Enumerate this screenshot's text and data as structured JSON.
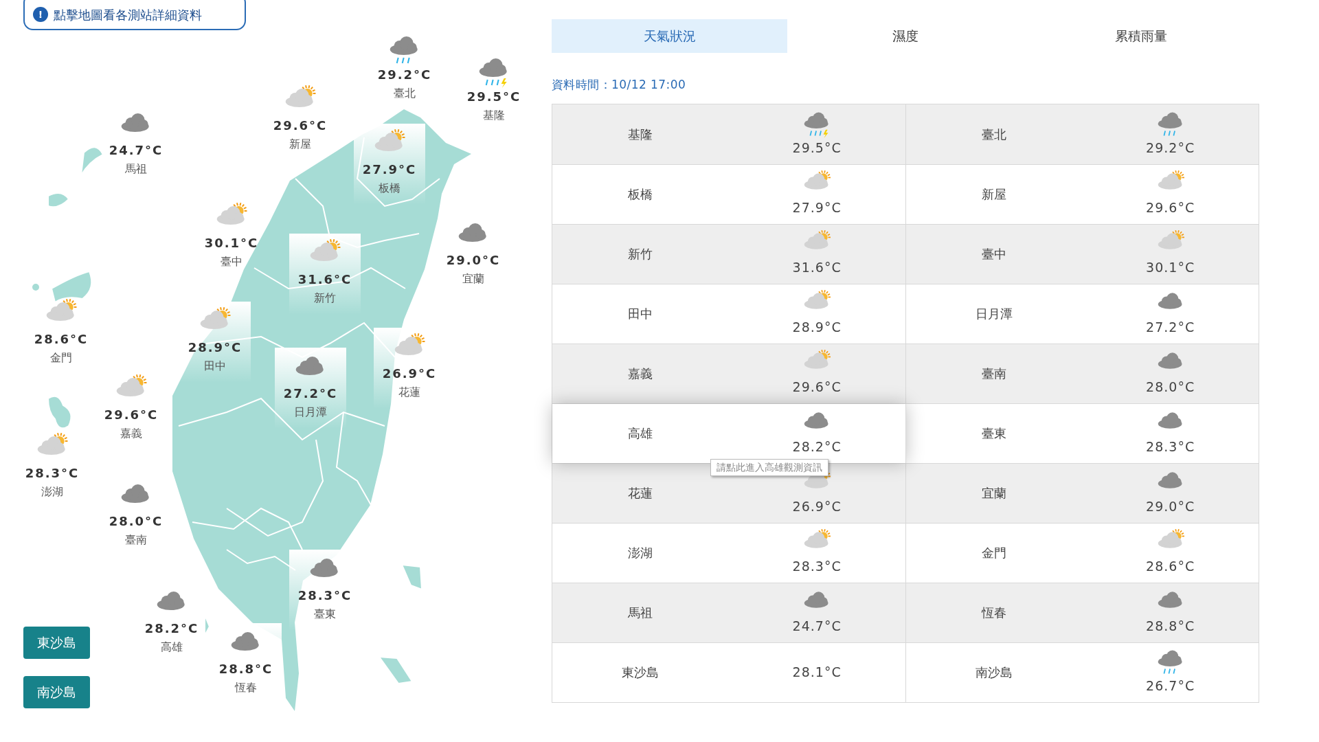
{
  "map_hint": {
    "icon": "!",
    "text": "點擊地圖看各測站詳細資料"
  },
  "map_stations": [
    {
      "name": "臺北",
      "temp": "29.2°C",
      "kind": "rain",
      "highlighted": false
    },
    {
      "name": "基隆",
      "temp": "29.5°C",
      "kind": "thunder",
      "highlighted": false
    },
    {
      "name": "新屋",
      "temp": "29.6°C",
      "kind": "suncloud",
      "highlighted": false
    },
    {
      "name": "馬祖",
      "temp": "24.7°C",
      "kind": "cloud",
      "highlighted": false
    },
    {
      "name": "板橋",
      "temp": "27.9°C",
      "kind": "suncloud",
      "highlighted": true
    },
    {
      "name": "臺中",
      "temp": "30.1°C",
      "kind": "suncloud",
      "highlighted": false
    },
    {
      "name": "宜蘭",
      "temp": "29.0°C",
      "kind": "cloud",
      "highlighted": false
    },
    {
      "name": "新竹",
      "temp": "31.6°C",
      "kind": "suncloud",
      "highlighted": true
    },
    {
      "name": "金門",
      "temp": "28.6°C",
      "kind": "suncloud",
      "highlighted": false
    },
    {
      "name": "田中",
      "temp": "28.9°C",
      "kind": "suncloud",
      "highlighted": true
    },
    {
      "name": "花蓮",
      "temp": "26.9°C",
      "kind": "suncloud",
      "highlighted": true
    },
    {
      "name": "日月潭",
      "temp": "27.2°C",
      "kind": "cloud",
      "highlighted": true
    },
    {
      "name": "嘉義",
      "temp": "29.6°C",
      "kind": "suncloud",
      "highlighted": false
    },
    {
      "name": "澎湖",
      "temp": "28.3°C",
      "kind": "suncloud",
      "highlighted": false
    },
    {
      "name": "臺南",
      "temp": "28.0°C",
      "kind": "cloud",
      "highlighted": false
    },
    {
      "name": "臺東",
      "temp": "28.3°C",
      "kind": "cloud",
      "highlighted": true
    },
    {
      "name": "高雄",
      "temp": "28.2°C",
      "kind": "cloud",
      "highlighted": false
    },
    {
      "name": "恆春",
      "temp": "28.8°C",
      "kind": "cloud",
      "highlighted": true
    }
  ],
  "island_buttons": [
    "東沙島",
    "南沙島"
  ],
  "tabs": [
    {
      "label": "天氣狀況",
      "selected": true
    },
    {
      "label": "濕度",
      "selected": false
    },
    {
      "label": "累積雨量",
      "selected": false
    }
  ],
  "data_time": "資料時間：10/12 17:00",
  "table_rows": [
    {
      "cells": [
        {
          "name": "基隆",
          "temp": "29.5°C",
          "kind": "thunder",
          "hovered": false
        },
        {
          "name": "臺北",
          "temp": "29.2°C",
          "kind": "rain",
          "hovered": false
        }
      ]
    },
    {
      "cells": [
        {
          "name": "板橋",
          "temp": "27.9°C",
          "kind": "suncloud",
          "hovered": false
        },
        {
          "name": "新屋",
          "temp": "29.6°C",
          "kind": "suncloud",
          "hovered": false
        }
      ]
    },
    {
      "cells": [
        {
          "name": "新竹",
          "temp": "31.6°C",
          "kind": "suncloud",
          "hovered": false
        },
        {
          "name": "臺中",
          "temp": "30.1°C",
          "kind": "suncloud",
          "hovered": false
        }
      ]
    },
    {
      "cells": [
        {
          "name": "田中",
          "temp": "28.9°C",
          "kind": "suncloud",
          "hovered": false
        },
        {
          "name": "日月潭",
          "temp": "27.2°C",
          "kind": "cloud",
          "hovered": false
        }
      ]
    },
    {
      "cells": [
        {
          "name": "嘉義",
          "temp": "29.6°C",
          "kind": "suncloud",
          "hovered": false
        },
        {
          "name": "臺南",
          "temp": "28.0°C",
          "kind": "cloud",
          "hovered": false
        }
      ]
    },
    {
      "cells": [
        {
          "name": "高雄",
          "temp": "28.2°C",
          "kind": "cloud",
          "hovered": true,
          "tooltip": "請點此進入高雄觀測資訊"
        },
        {
          "name": "臺東",
          "temp": "28.3°C",
          "kind": "cloud",
          "hovered": false
        }
      ]
    },
    {
      "cells": [
        {
          "name": "花蓮",
          "temp": "26.9°C",
          "kind": "suncloud",
          "hovered": false
        },
        {
          "name": "宜蘭",
          "temp": "29.0°C",
          "kind": "cloud",
          "hovered": false
        }
      ]
    },
    {
      "cells": [
        {
          "name": "澎湖",
          "temp": "28.3°C",
          "kind": "suncloud",
          "hovered": false
        },
        {
          "name": "金門",
          "temp": "28.6°C",
          "kind": "suncloud",
          "hovered": false
        }
      ]
    },
    {
      "cells": [
        {
          "name": "馬祖",
          "temp": "24.7°C",
          "kind": "cloud",
          "hovered": false
        },
        {
          "name": "恆春",
          "temp": "28.8°C",
          "kind": "cloud",
          "hovered": false
        }
      ]
    },
    {
      "cells": [
        {
          "name": "東沙島",
          "temp": "28.1°C",
          "kind": "plain",
          "hovered": false
        },
        {
          "name": "南沙島",
          "temp": "26.7°C",
          "kind": "rain",
          "hovered": false
        }
      ]
    }
  ]
}
